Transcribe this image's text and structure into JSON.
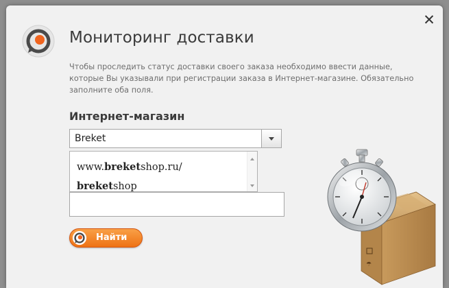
{
  "dialog": {
    "close_label": "✕",
    "title": "Мониторинг доставки",
    "description": "Чтобы проследить статус доставки своего заказа необходимо ввести данные, которые Вы указывали при регистрации заказа в Интернет-магазине. Обязательно заполните оба поля."
  },
  "shop_field": {
    "label": "Интернет-магазин",
    "value": "Breket",
    "options": [
      {
        "prefix": "www.",
        "match": "breket",
        "suffix": "shop.ru/"
      },
      {
        "prefix": "",
        "match": "breket",
        "suffix": "shop"
      }
    ]
  },
  "order_field": {
    "value": "",
    "placeholder": ""
  },
  "search_button": {
    "label": "Найти",
    "icon": "logo-icon"
  },
  "colors": {
    "accent": "#ee7214",
    "logo_orange": "#f0641e",
    "logo_gray": "#4a4a4a"
  }
}
